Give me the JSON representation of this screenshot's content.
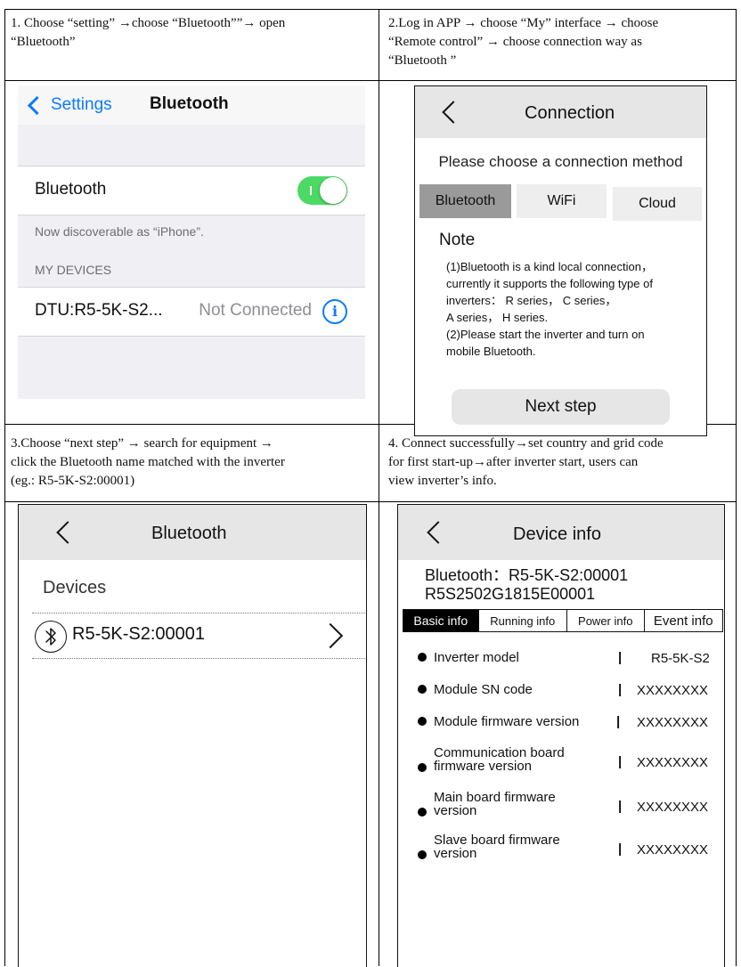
{
  "steps": [
    {
      "caption_lines": [
        "1. Choose “setting” →choose “Bluetooth””→ open",
        "“Bluetooth”"
      ],
      "screen": {
        "back_label": "Settings",
        "title": "Bluetooth",
        "bluetooth_label": "Bluetooth",
        "bluetooth_on": true,
        "discoverable_text": "Now discoverable as “iPhone”.",
        "section_header": "MY DEVICES",
        "device_name": "DTU:R5-5K-S2...",
        "device_status": "Not Connected",
        "info_icon": "info-icon"
      }
    },
    {
      "caption_lines": [
        "2.Log in APP → choose “My” interface → choose",
        "“Remote control” → choose connection way as",
        "“Bluetooth ”"
      ],
      "screen": {
        "title": "Connection",
        "subtitle": "Please choose a connection method",
        "tabs": [
          "Bluetooth",
          "WiFi",
          "Cloud"
        ],
        "active_tab": "Bluetooth",
        "note_title": "Note",
        "note_lines": [
          "(1)Bluetooth is a kind local connection，",
          "currently it supports the following type of",
          "inverters： R series， C series，",
          "A series，  H series.",
          "(2)Please start the inverter and turn on",
          "mobile Bluetooth."
        ],
        "next_button": "Next step"
      }
    },
    {
      "caption_lines": [
        "3.Choose “next step” → search for equipment →",
        "click the Bluetooth name matched with the inverter",
        "(eg.: R5-5K-S2:00001)"
      ],
      "screen": {
        "title": "Bluetooth",
        "devices_header": "Devices",
        "device_name": "R5-5K-S2:00001",
        "device_icon": "bluetooth-icon"
      }
    },
    {
      "caption_lines": [
        "4. Connect successfully→set country and grid code",
        "for first start-up→after inverter start, users can",
        "view inverter’s info."
      ],
      "screen": {
        "title": "Device info",
        "bluetooth_line": "Bluetooth：R5-5K-S2:00001",
        "serial_line": "R5S2502G1815E00001",
        "tabs": [
          "Basic info",
          "Running info",
          "Power info",
          "Event info"
        ],
        "active_tab": "Basic info",
        "separator": "|",
        "rows": [
          {
            "label_lines": [
              "Inverter model"
            ],
            "value": "R5-5K-S2"
          },
          {
            "label_lines": [
              "Module SN code"
            ],
            "value": "XXXXXXXX"
          },
          {
            "label_lines": [
              "Module firmware version"
            ],
            "value": "XXXXXXXX"
          },
          {
            "label_lines": [
              "Communication board",
              "firmware version"
            ],
            "value": "XXXXXXXX"
          },
          {
            "label_lines": [
              "Main board firmware",
              "version"
            ],
            "value": "XXXXXXXX"
          },
          {
            "label_lines": [
              "Slave board firmware",
              "version"
            ],
            "value": "XXXXXXXX"
          }
        ]
      }
    }
  ],
  "colors": {
    "ios_blue": "#0b7aff",
    "toggle_green": "#4cd964",
    "ios_background": "#efeff4",
    "app_bar_gray": "#e6e6e6",
    "active_tab_gray": "#9a9a9a"
  }
}
